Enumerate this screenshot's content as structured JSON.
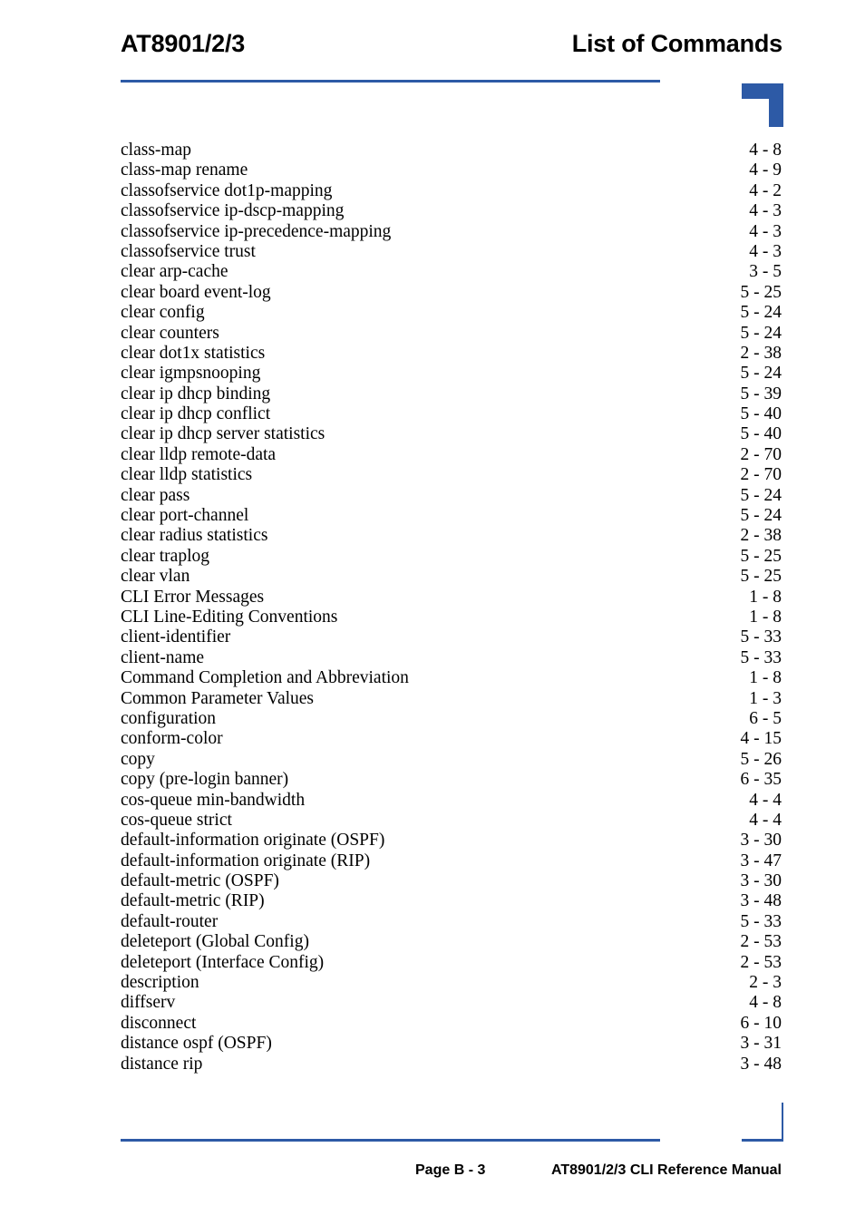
{
  "header": {
    "product": "AT8901/2/3",
    "section_title": "List of Commands",
    "accent_color": "#2d5aa6",
    "tab_marker_icon": "corner-tab-marker-icon"
  },
  "footer": {
    "page_label": "Page B - 3",
    "manual_title": "AT8901/2/3 CLI Reference Manual",
    "corner_icon": "corner-rule-icon"
  },
  "index": {
    "entries": [
      {
        "label": "class-map",
        "page": "4 - 8"
      },
      {
        "label": "class-map rename",
        "page": "4 - 9"
      },
      {
        "label": "classofservice dot1p-mapping",
        "page": "4 - 2"
      },
      {
        "label": "classofservice ip-dscp-mapping",
        "page": "4 - 3"
      },
      {
        "label": "classofservice ip-precedence-mapping",
        "page": "4 - 3"
      },
      {
        "label": "classofservice trust",
        "page": "4 - 3"
      },
      {
        "label": "clear arp-cache",
        "page": "3 - 5"
      },
      {
        "label": "clear board event-log",
        "page": "5 - 25"
      },
      {
        "label": "clear config",
        "page": "5 - 24"
      },
      {
        "label": "clear counters",
        "page": "5 - 24"
      },
      {
        "label": "clear dot1x statistics",
        "page": "2 - 38"
      },
      {
        "label": "clear igmpsnooping",
        "page": "5 - 24"
      },
      {
        "label": "clear ip dhcp binding",
        "page": "5 - 39"
      },
      {
        "label": "clear ip dhcp conflict",
        "page": "5 - 40"
      },
      {
        "label": "clear ip dhcp server statistics",
        "page": "5 - 40"
      },
      {
        "label": "clear lldp remote-data",
        "page": "2 - 70"
      },
      {
        "label": "clear lldp statistics",
        "page": "2 - 70"
      },
      {
        "label": "clear pass",
        "page": "5 - 24"
      },
      {
        "label": "clear port-channel",
        "page": "5 - 24"
      },
      {
        "label": "clear radius statistics",
        "page": "2 - 38"
      },
      {
        "label": "clear traplog",
        "page": "5 - 25"
      },
      {
        "label": "clear vlan",
        "page": "5 - 25"
      },
      {
        "label": "CLI Error Messages",
        "page": "1 - 8"
      },
      {
        "label": "CLI Line-Editing Conventions",
        "page": "1 - 8"
      },
      {
        "label": "client-identifier",
        "page": "5 - 33"
      },
      {
        "label": "client-name",
        "page": "5 - 33"
      },
      {
        "label": "Command Completion and Abbreviation",
        "page": "1 - 8"
      },
      {
        "label": "Common Parameter Values",
        "page": "1 - 3"
      },
      {
        "label": "configuration",
        "page": "6 - 5"
      },
      {
        "label": "conform-color",
        "page": "4 - 15"
      },
      {
        "label": "copy",
        "page": "5 - 26"
      },
      {
        "label": "copy (pre-login banner)",
        "page": "6 - 35"
      },
      {
        "label": "cos-queue min-bandwidth",
        "page": "4 - 4"
      },
      {
        "label": "cos-queue strict",
        "page": "4 - 4"
      },
      {
        "label": "default-information originate (OSPF)",
        "page": "3 - 30"
      },
      {
        "label": "default-information originate (RIP)",
        "page": "3 - 47"
      },
      {
        "label": "default-metric (OSPF)",
        "page": "3 - 30"
      },
      {
        "label": "default-metric (RIP)",
        "page": "3 - 48"
      },
      {
        "label": "default-router",
        "page": "5 - 33"
      },
      {
        "label": "deleteport (Global Config)",
        "page": "2 - 53"
      },
      {
        "label": "deleteport (Interface Config)",
        "page": "2 - 53"
      },
      {
        "label": "description",
        "page": "2 - 3"
      },
      {
        "label": "diffserv",
        "page": "4 - 8"
      },
      {
        "label": "disconnect",
        "page": "6 - 10"
      },
      {
        "label": "distance ospf (OSPF)",
        "page": "3 - 31"
      },
      {
        "label": "distance rip",
        "page": "3 - 48"
      }
    ]
  }
}
